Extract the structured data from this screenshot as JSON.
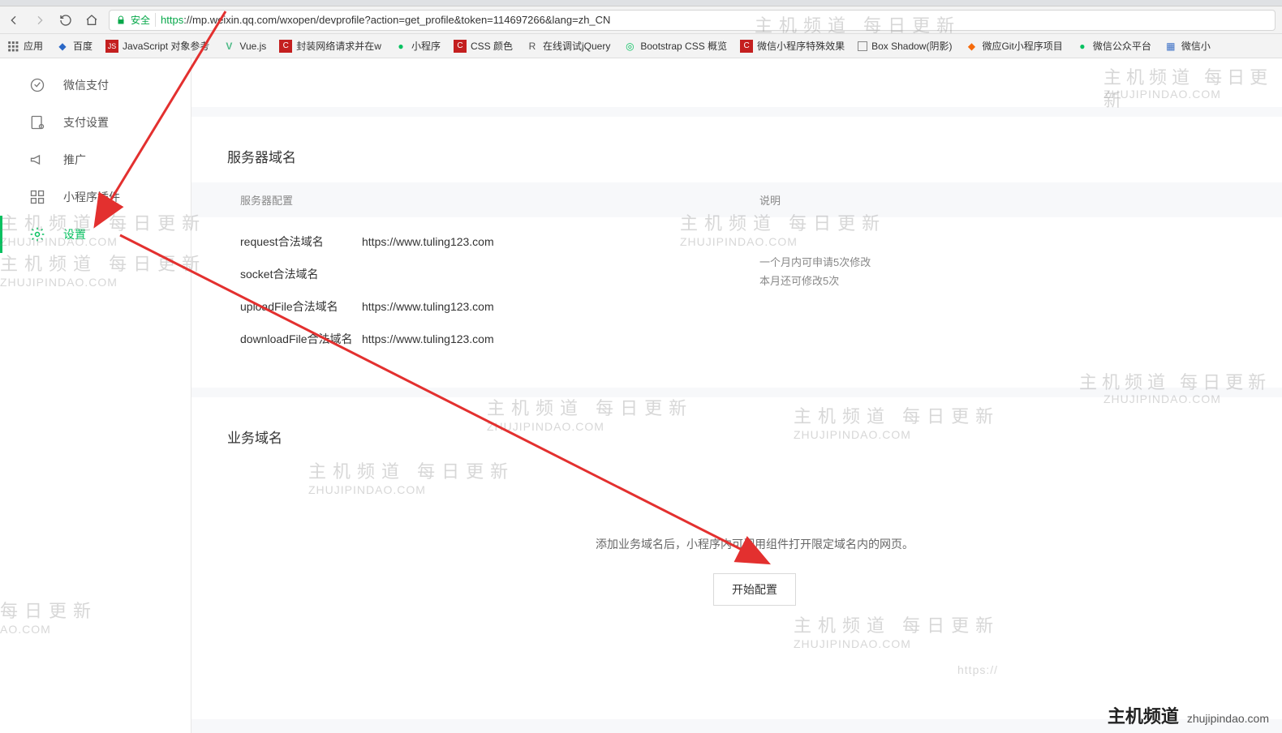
{
  "browser": {
    "secure_label": "安全",
    "url_https": "https",
    "url_rest": "://mp.weixin.qq.com/wxopen/devprofile?action=get_profile&token=114697266&lang=zh_CN"
  },
  "bookmarks": {
    "apps": "应用",
    "items": [
      {
        "label": "百度",
        "color": "#2a67c6"
      },
      {
        "label": "JavaScript 对象参考",
        "color": "#c41f1f"
      },
      {
        "label": "Vue.js",
        "color": "#4dba87"
      },
      {
        "label": "封装网络请求并在w",
        "color": "#c41f1f"
      },
      {
        "label": "小程序",
        "color": "#07c160"
      },
      {
        "label": "CSS 颜色",
        "color": "#c41f1f"
      },
      {
        "label": "在线调试jQuery",
        "color": "#555"
      },
      {
        "label": "Bootstrap CSS 概览",
        "color": "#07c160"
      },
      {
        "label": "微信小程序特殊效果",
        "color": "#c41f1f"
      },
      {
        "label": "Box Shadow(阴影)",
        "color": "#555"
      },
      {
        "label": "微应Git小程序项目",
        "color": "#f66a0a"
      },
      {
        "label": "微信公众平台",
        "color": "#07c160"
      },
      {
        "label": "微信小",
        "color": "#555"
      }
    ]
  },
  "sidebar": {
    "items": [
      {
        "label": "微信支付",
        "icon": "wallet"
      },
      {
        "label": "支付设置",
        "icon": "pay-setting"
      },
      {
        "label": "推广",
        "icon": "megaphone"
      },
      {
        "label": "小程序插件",
        "icon": "plugin"
      },
      {
        "label": "设置",
        "icon": "gear",
        "active": true
      }
    ]
  },
  "server": {
    "title": "服务器域名",
    "head_config": "服务器配置",
    "head_desc": "说明",
    "rows": [
      {
        "label": "request合法域名",
        "value": "https://www.tuling123.com"
      },
      {
        "label": "socket合法域名",
        "value": ""
      },
      {
        "label": "uploadFile合法域名",
        "value": "https://www.tuling123.com"
      },
      {
        "label": "downloadFile合法域名",
        "value": "https://www.tuling123.com"
      }
    ],
    "desc_line1": "一个月内可申请5次修改",
    "desc_line2": "本月还可修改5次"
  },
  "biz": {
    "title": "业务域名",
    "hint": "添加业务域名后，小程序内可调用组件打开限定域名内的网页。",
    "button": "开始配置"
  },
  "watermarks": {
    "big": "主机频道 每日更新",
    "small": "ZHUJIPINDAO.COM",
    "big_part1": "每日更新",
    "small_part1": "AO.COM",
    "footer_cn": "主机频道",
    "footer_en": "zhujipindao.com",
    "https_part": "https://"
  }
}
